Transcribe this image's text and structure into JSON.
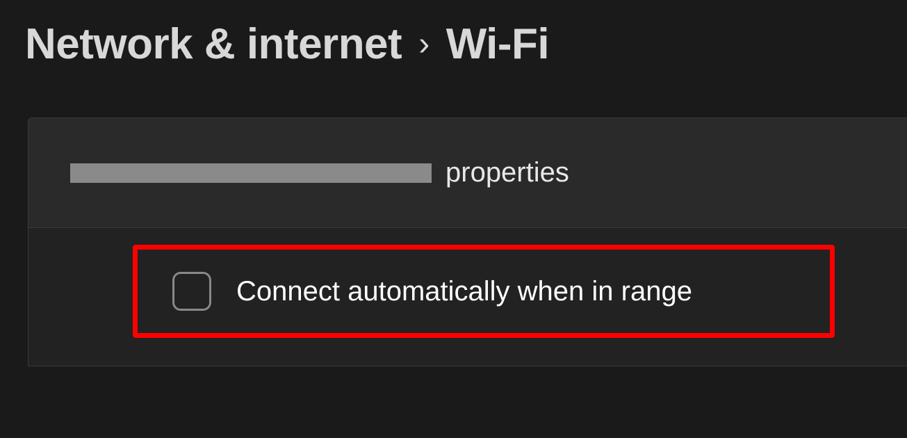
{
  "breadcrumb": {
    "parent": "Network & internet",
    "separator": "›",
    "current": "Wi-Fi"
  },
  "panel": {
    "properties_label": "properties",
    "connect_auto_label": "Connect automatically when in range"
  }
}
